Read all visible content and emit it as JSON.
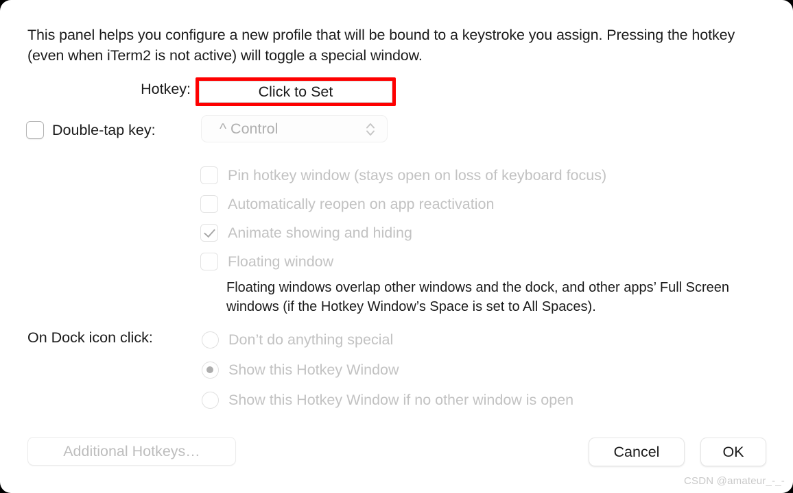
{
  "dialog": {
    "intro_text": "This panel helps you configure a new profile that will be bound to a keystroke you assign. Pressing the hotkey (even when iTerm2 is not active) will toggle a special window.",
    "accent_highlight_color": "#fe0000"
  },
  "hotkey": {
    "label": "Hotkey:",
    "button_label": "Click to Set"
  },
  "double_tap": {
    "label": "Double-tap key:",
    "checked": false,
    "select_value": "^ Control",
    "stepper_icon": "chevron-up-down-icon"
  },
  "options": [
    {
      "label": "Pin hotkey window (stays open on loss of keyboard focus)",
      "checked": false
    },
    {
      "label": "Automatically reopen on app reactivation",
      "checked": false
    },
    {
      "label": "Animate showing and hiding",
      "checked": true
    },
    {
      "label": "Floating window",
      "checked": false
    }
  ],
  "floating_note": "Floating windows overlap other windows and the dock, and other apps’ Full Screen windows (if the Hotkey Window’s Space is set to All Spaces).",
  "dock_click": {
    "label": "On Dock icon click:",
    "options": [
      {
        "label": "Don’t do anything special",
        "selected": false
      },
      {
        "label": "Show this Hotkey Window",
        "selected": true
      },
      {
        "label": "Show this Hotkey Window if no other window is open",
        "selected": false
      }
    ]
  },
  "footer": {
    "additional_hotkeys_label": "Additional Hotkeys…",
    "cancel_label": "Cancel",
    "ok_label": "OK"
  },
  "watermark": "CSDN @amateur_-_-"
}
